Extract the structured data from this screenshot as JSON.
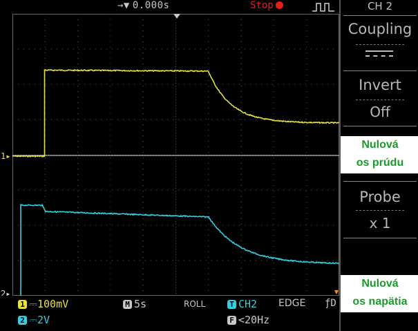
{
  "topbar": {
    "time_offset": "0.000s",
    "run_state": "Stop"
  },
  "menu": {
    "title": "CH 2",
    "coupling_label": "Coupling",
    "invert_label": "Invert",
    "invert_value": "Off",
    "probe_label": "Probe",
    "probe_value": "x 1"
  },
  "annotations": {
    "current_zero": [
      "Nulová",
      "os prúdu"
    ],
    "voltage_zero": [
      "Nulová",
      "os napätia"
    ]
  },
  "markers": {
    "ch1": "1",
    "ch2": "2"
  },
  "status": {
    "ch1_badge": "1",
    "ch1_scale": "100mV",
    "ch2_badge": "2",
    "ch2_scale": "2V",
    "timebase_badge": "M",
    "timebase": "5s",
    "mode": "ROLL",
    "trig_badge": "T",
    "trig_source": "CH2",
    "trig_type": "EDGE",
    "filter_badge": "F",
    "filter": "<20Hz"
  },
  "colors": {
    "ch1": "#e8e040",
    "ch2": "#30d0e0",
    "grid": "#5a5a5a",
    "annotation_text": "#1a9a2a",
    "stop": "#e02020"
  }
}
